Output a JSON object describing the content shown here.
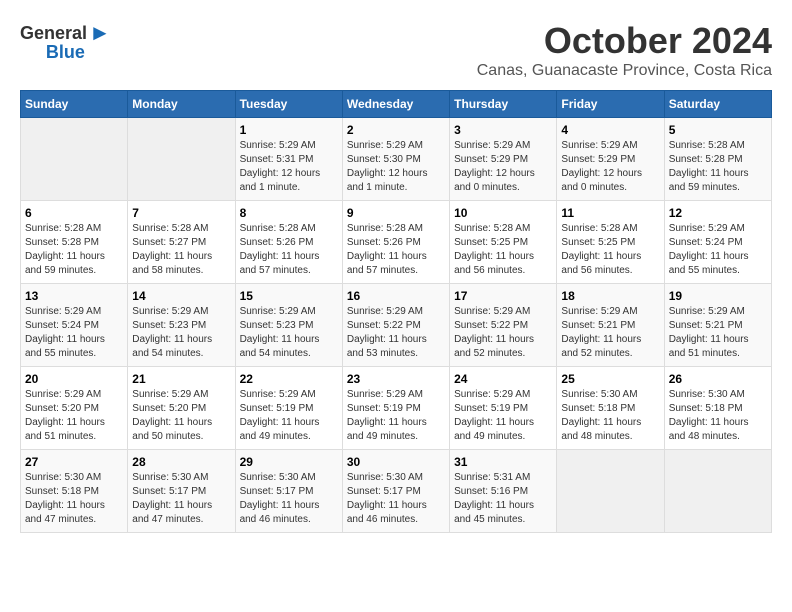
{
  "logo": {
    "general": "General",
    "blue": "Blue"
  },
  "title": "October 2024",
  "subtitle": "Canas, Guanacaste Province, Costa Rica",
  "days_of_week": [
    "Sunday",
    "Monday",
    "Tuesday",
    "Wednesday",
    "Thursday",
    "Friday",
    "Saturday"
  ],
  "weeks": [
    [
      {
        "day": "",
        "info": ""
      },
      {
        "day": "",
        "info": ""
      },
      {
        "day": "1",
        "info": "Sunrise: 5:29 AM\nSunset: 5:31 PM\nDaylight: 12 hours and 1 minute."
      },
      {
        "day": "2",
        "info": "Sunrise: 5:29 AM\nSunset: 5:30 PM\nDaylight: 12 hours and 1 minute."
      },
      {
        "day": "3",
        "info": "Sunrise: 5:29 AM\nSunset: 5:29 PM\nDaylight: 12 hours and 0 minutes."
      },
      {
        "day": "4",
        "info": "Sunrise: 5:29 AM\nSunset: 5:29 PM\nDaylight: 12 hours and 0 minutes."
      },
      {
        "day": "5",
        "info": "Sunrise: 5:28 AM\nSunset: 5:28 PM\nDaylight: 11 hours and 59 minutes."
      }
    ],
    [
      {
        "day": "6",
        "info": "Sunrise: 5:28 AM\nSunset: 5:28 PM\nDaylight: 11 hours and 59 minutes."
      },
      {
        "day": "7",
        "info": "Sunrise: 5:28 AM\nSunset: 5:27 PM\nDaylight: 11 hours and 58 minutes."
      },
      {
        "day": "8",
        "info": "Sunrise: 5:28 AM\nSunset: 5:26 PM\nDaylight: 11 hours and 57 minutes."
      },
      {
        "day": "9",
        "info": "Sunrise: 5:28 AM\nSunset: 5:26 PM\nDaylight: 11 hours and 57 minutes."
      },
      {
        "day": "10",
        "info": "Sunrise: 5:28 AM\nSunset: 5:25 PM\nDaylight: 11 hours and 56 minutes."
      },
      {
        "day": "11",
        "info": "Sunrise: 5:28 AM\nSunset: 5:25 PM\nDaylight: 11 hours and 56 minutes."
      },
      {
        "day": "12",
        "info": "Sunrise: 5:29 AM\nSunset: 5:24 PM\nDaylight: 11 hours and 55 minutes."
      }
    ],
    [
      {
        "day": "13",
        "info": "Sunrise: 5:29 AM\nSunset: 5:24 PM\nDaylight: 11 hours and 55 minutes."
      },
      {
        "day": "14",
        "info": "Sunrise: 5:29 AM\nSunset: 5:23 PM\nDaylight: 11 hours and 54 minutes."
      },
      {
        "day": "15",
        "info": "Sunrise: 5:29 AM\nSunset: 5:23 PM\nDaylight: 11 hours and 54 minutes."
      },
      {
        "day": "16",
        "info": "Sunrise: 5:29 AM\nSunset: 5:22 PM\nDaylight: 11 hours and 53 minutes."
      },
      {
        "day": "17",
        "info": "Sunrise: 5:29 AM\nSunset: 5:22 PM\nDaylight: 11 hours and 52 minutes."
      },
      {
        "day": "18",
        "info": "Sunrise: 5:29 AM\nSunset: 5:21 PM\nDaylight: 11 hours and 52 minutes."
      },
      {
        "day": "19",
        "info": "Sunrise: 5:29 AM\nSunset: 5:21 PM\nDaylight: 11 hours and 51 minutes."
      }
    ],
    [
      {
        "day": "20",
        "info": "Sunrise: 5:29 AM\nSunset: 5:20 PM\nDaylight: 11 hours and 51 minutes."
      },
      {
        "day": "21",
        "info": "Sunrise: 5:29 AM\nSunset: 5:20 PM\nDaylight: 11 hours and 50 minutes."
      },
      {
        "day": "22",
        "info": "Sunrise: 5:29 AM\nSunset: 5:19 PM\nDaylight: 11 hours and 49 minutes."
      },
      {
        "day": "23",
        "info": "Sunrise: 5:29 AM\nSunset: 5:19 PM\nDaylight: 11 hours and 49 minutes."
      },
      {
        "day": "24",
        "info": "Sunrise: 5:29 AM\nSunset: 5:19 PM\nDaylight: 11 hours and 49 minutes."
      },
      {
        "day": "25",
        "info": "Sunrise: 5:30 AM\nSunset: 5:18 PM\nDaylight: 11 hours and 48 minutes."
      },
      {
        "day": "26",
        "info": "Sunrise: 5:30 AM\nSunset: 5:18 PM\nDaylight: 11 hours and 48 minutes."
      }
    ],
    [
      {
        "day": "27",
        "info": "Sunrise: 5:30 AM\nSunset: 5:18 PM\nDaylight: 11 hours and 47 minutes."
      },
      {
        "day": "28",
        "info": "Sunrise: 5:30 AM\nSunset: 5:17 PM\nDaylight: 11 hours and 47 minutes."
      },
      {
        "day": "29",
        "info": "Sunrise: 5:30 AM\nSunset: 5:17 PM\nDaylight: 11 hours and 46 minutes."
      },
      {
        "day": "30",
        "info": "Sunrise: 5:30 AM\nSunset: 5:17 PM\nDaylight: 11 hours and 46 minutes."
      },
      {
        "day": "31",
        "info": "Sunrise: 5:31 AM\nSunset: 5:16 PM\nDaylight: 11 hours and 45 minutes."
      },
      {
        "day": "",
        "info": ""
      },
      {
        "day": "",
        "info": ""
      }
    ]
  ]
}
